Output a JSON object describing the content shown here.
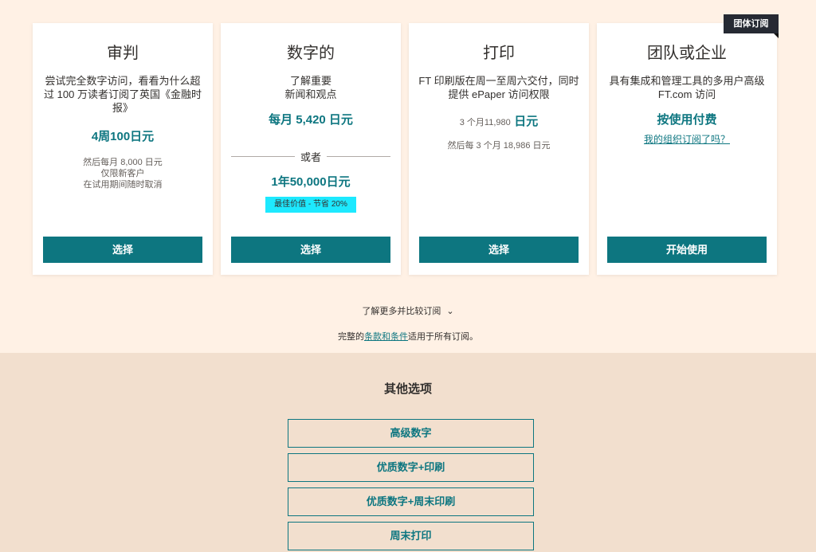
{
  "group_tag": "团体订阅",
  "cards": [
    {
      "title": "审判",
      "desc": "尝试完全数字访问，看看为什么超过 100 万读者订阅了英国《金融时报》",
      "price": "4周100日元",
      "notes": [
        "然后每月 8,000 日元",
        "仅限新客户",
        "在试用期间随时取消"
      ],
      "button": "选择"
    },
    {
      "title": "数字的",
      "desc_lines": [
        "了解重要",
        "新闻和观点"
      ],
      "price": "每月 5,420 日元",
      "or": "或者",
      "price_alt": "1年50,000日元",
      "badge": "最佳价值 - 节省 20%",
      "button": "选择"
    },
    {
      "title": "打印",
      "desc": "FT 印刷版在周一至周六交付，同时提供 ePaper 访问权限",
      "price_prefix": "3 个月11,980",
      "price_suffix": "日元",
      "note": "然后每 3 个月 18,986 日元",
      "button": "选择"
    },
    {
      "title": "团队或企业",
      "desc": "具有集成和管理工具的多用户高级 FT.com 访问",
      "price": "按使用付费",
      "link": "我的组织订阅了吗？",
      "button": "开始使用"
    }
  ],
  "learn_more": "了解更多并比较订阅",
  "terms": {
    "prefix": "完整的",
    "link": "条款和条件",
    "suffix": "适用于所有订阅。"
  },
  "other_options": {
    "title": "其他选项",
    "buttons": [
      "高级数字",
      "优质数字+印刷",
      "优质数字+周末印刷",
      "周末打印"
    ]
  },
  "colors": {
    "accent": "#0d7680",
    "page_bg": "#fff1e5",
    "lower_bg": "#f2dfce",
    "badge_bg": "#1de9ff",
    "tag_bg": "#262a33"
  }
}
